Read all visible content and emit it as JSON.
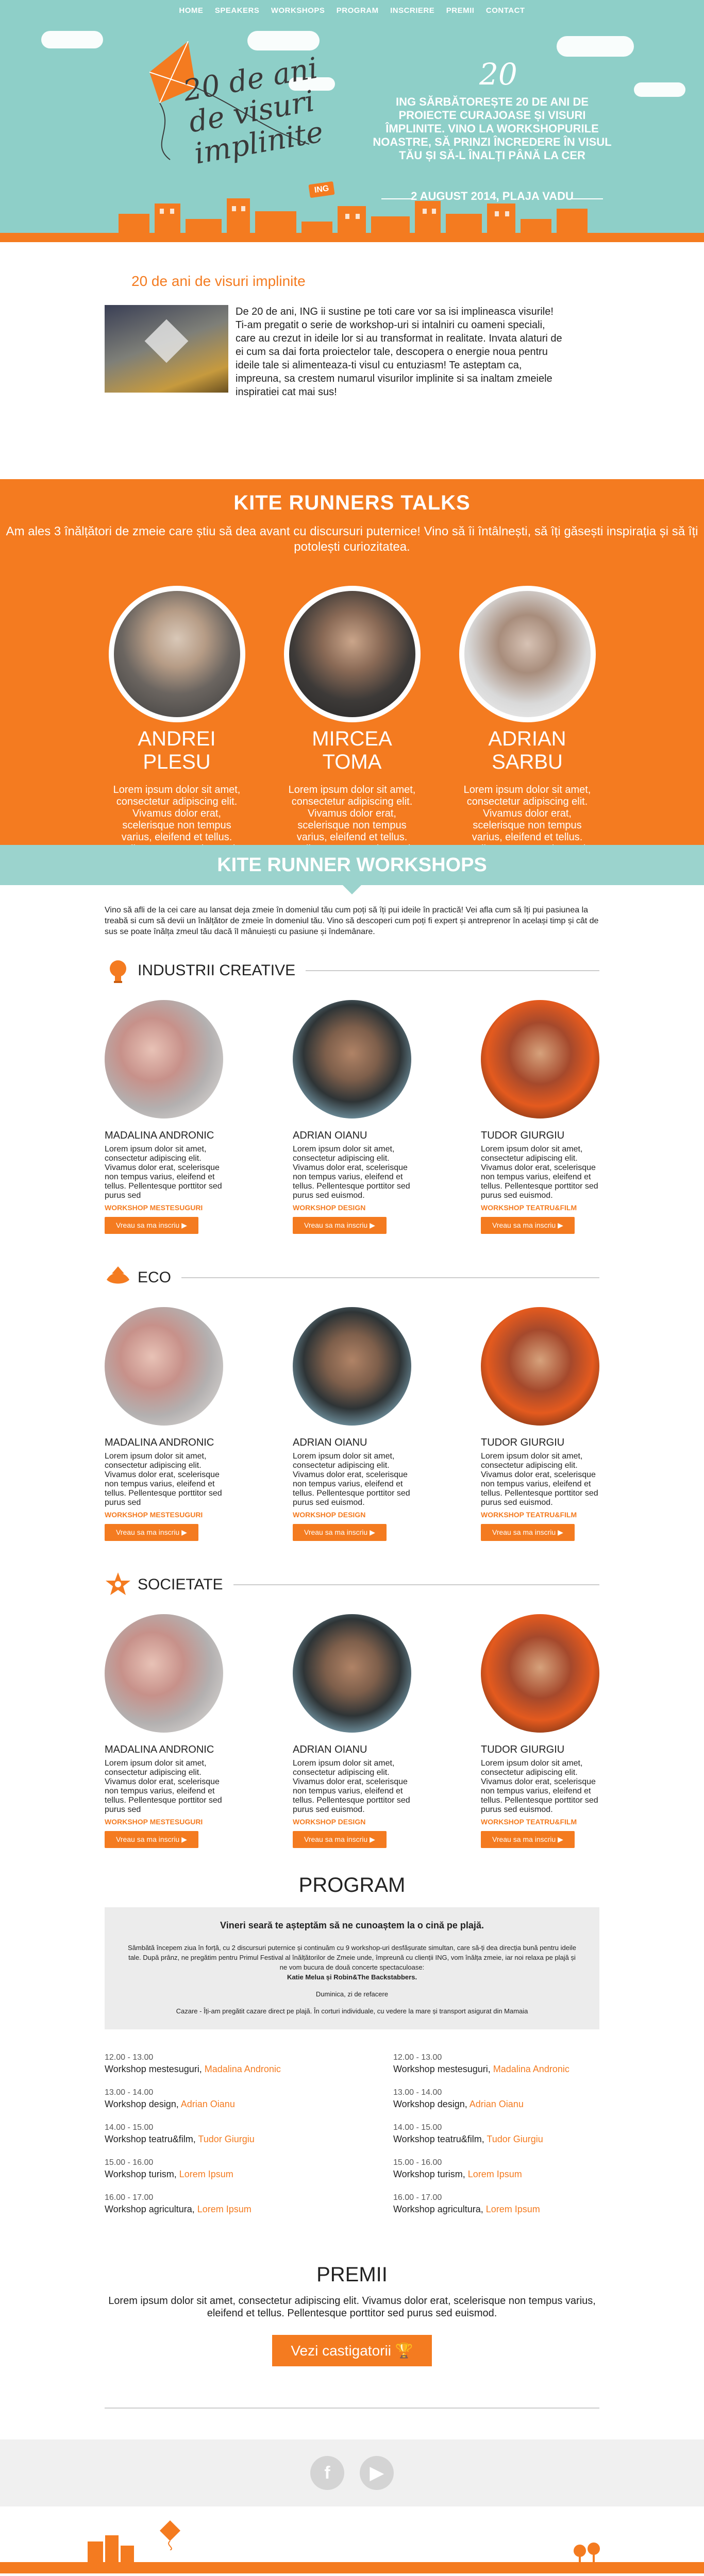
{
  "nav": [
    "HOME",
    "SPEAKERS",
    "WORKSHOPS",
    "PROGRAM",
    "INSCRIERE",
    "PREMII",
    "CONTACT"
  ],
  "hero": {
    "logo_line1": "20 de ani",
    "logo_line2": "de visuri",
    "logo_line3": "implinite",
    "badge": "ING",
    "twenty": "20",
    "tagline": "ING SĂRBĂTOREȘTE 20 DE ANI DE PROIECTE CURAJOASE ȘI VISURI ÎMPLINITE. VINO LA WORKSHOPURILE NOASTRE, SĂ PRINZI ÎNCREDERE ÎN VISUL TĂU ȘI SĂ-L ÎNALȚI PÂNĂ LA CER",
    "date": "2 AUGUST 2014, PLAJA VADU"
  },
  "intro": {
    "title": "20 de ani de visuri implinite",
    "text": "De 20 de ani, ING ii sustine pe toti care vor sa isi implineasca visurile! Ti-am pregatit o serie de workshop-uri si intalniri cu oameni speciali, care au crezut in ideile lor si au transformat in realitate. Invata alaturi de ei cum sa dai forta proiectelor tale, descopera o energie noua pentru ideile tale si alimenteaza-ti visul cu entuziasm! Te asteptam ca, impreuna, sa crestem numarul visurilor implinite si sa inaltam zmeiele inspiratiei cat mai sus!"
  },
  "talks": {
    "title": "KITE RUNNERS TALKS",
    "lead": "Am ales 3 înălțători de zmeie care știu să dea avant cu discursuri puternice! Vino să îi întâlnești, să îți găsești inspirația și să îți potolești curiozitatea.",
    "speakers": [
      {
        "name": "ANDREI PLESU",
        "text": "Lorem ipsum dolor sit amet, consectetur adipiscing elit. Vivamus dolor erat, scelerisque non tempus varius, eleifend et tellus. Pellentesque porttitor sed"
      },
      {
        "name": "MIRCEA TOMA",
        "text": "Lorem ipsum dolor sit amet, consectetur adipiscing elit. Vivamus dolor erat, scelerisque non tempus varius, eleifend et tellus. Pellentesque porttitor sed"
      },
      {
        "name": "ADRIAN SARBU",
        "text": "Lorem ipsum dolor sit amet, consectetur adipiscing elit. Vivamus dolor erat, scelerisque non tempus varius, eleifend et tellus. Pellentesque porttitor sed"
      }
    ]
  },
  "workshops": {
    "title": "KITE RUNNER WORKSHOPS",
    "intro": "Vino să afli de la cei care au lansat deja zmeie în domeniul tău cum poți să îți pui ideile în practică! Vei afla cum să îți pui pasiunea la treabă si cum să devii un înălțător de zmeie în domeniul tău. Vino să descoperi cum poți fi expert și antreprenor în același timp și cât de sus se poate înălța zmeul tău dacă îl mânuiești cu pasiune și îndemânare.",
    "button": "Vreau sa ma inscriu",
    "categories": [
      {
        "name": "INDUSTRII CREATIVE",
        "icon": "lightbulb-icon"
      },
      {
        "name": "ECO",
        "icon": "leaf-icon"
      },
      {
        "name": "SOCIETATE",
        "icon": "star-badge-icon"
      }
    ],
    "cards": [
      {
        "name": "MADALINA ANDRONIC",
        "text": "Lorem ipsum dolor sit amet, consectetur adipiscing elit. Vivamus dolor erat, scelerisque non tempus varius, eleifend et tellus. Pellentesque porttitor sed purus sed",
        "tag": "WORKSHOP MESTESUGURI"
      },
      {
        "name": "ADRIAN OIANU",
        "text": "Lorem ipsum dolor sit amet, consectetur adipiscing elit. Vivamus dolor erat, scelerisque non tempus varius, eleifend et tellus. Pellentesque porttitor sed purus sed euismod.",
        "tag": "WORKSHOP DESIGN"
      },
      {
        "name": "TUDOR GIURGIU",
        "text": "Lorem ipsum dolor sit amet, consectetur adipiscing elit. Vivamus dolor erat, scelerisque non tempus varius, eleifend et tellus. Pellentesque porttitor sed purus sed euismod.",
        "tag": "WORKSHOP TEATRU&FILM"
      }
    ]
  },
  "program": {
    "title": "PROGRAM",
    "box_title": "Vineri seară te așteptăm să ne cunoaștem la o cină pe plajă.",
    "box_p1": "Sâmbătă începem ziua în forță, cu 2 discursuri puternice și continuăm cu 9 workshop-uri desfășurate simultan, care să-ți dea direcția bună pentru ideile tale. După prânz, ne pregătim pentru Primul Festival al înălțătorilor de Zmeie unde, împreună cu clienții ING, vom înălța zmeie, iar noi relaxa pe plajă și ne vom bucura de două concerte spectaculoase:",
    "box_p2": "Katie Melua și Robin&The Backstabbers.",
    "box_p3": "Duminica, zi de refacere",
    "box_p4": "Cazare - Îți-am pregătit cazare direct pe plajă. În corturi individuale, cu vedere la mare și transport asigurat din Mamaia",
    "left": [
      {
        "time": "12.00 - 13.00",
        "title": "Workshop mestesuguri, ",
        "who": "Madalina Andronic"
      },
      {
        "time": "13.00 - 14.00",
        "title": "Workshop design, ",
        "who": "Adrian Oianu"
      },
      {
        "time": "14.00 - 15.00",
        "title": "Workshop teatru&film, ",
        "who": "Tudor Giurgiu"
      },
      {
        "time": "15.00 - 16.00",
        "title": "Workshop turism, ",
        "who": "Lorem Ipsum"
      },
      {
        "time": "16.00 - 17.00",
        "title": "Workshop agricultura, ",
        "who": "Lorem Ipsum"
      }
    ],
    "right": [
      {
        "time": "12.00 - 13.00",
        "title": "Workshop mestesuguri, ",
        "who": "Madalina Andronic"
      },
      {
        "time": "13.00 - 14.00",
        "title": "Workshop design, ",
        "who": "Adrian Oianu"
      },
      {
        "time": "14.00 - 15.00",
        "title": "Workshop teatru&film, ",
        "who": "Tudor Giurgiu"
      },
      {
        "time": "15.00 - 16.00",
        "title": "Workshop turism, ",
        "who": "Lorem Ipsum"
      },
      {
        "time": "16.00 - 17.00",
        "title": "Workshop agricultura, ",
        "who": "Lorem Ipsum"
      }
    ]
  },
  "premii": {
    "title": "PREMII",
    "text": "Lorem ipsum dolor sit amet, consectetur adipiscing elit. Vivamus dolor erat, scelerisque non tempus varius, eleifend et tellus. Pellentesque porttitor sed purus sed euismod.",
    "button": "Vezi castigatorii"
  },
  "social": {
    "facebook_glyph": "f",
    "youtube_glyph": "▶"
  },
  "colors": {
    "accent": "#f47b20",
    "teal": "#8ecfc8",
    "teal_light": "#9bd3cd"
  }
}
